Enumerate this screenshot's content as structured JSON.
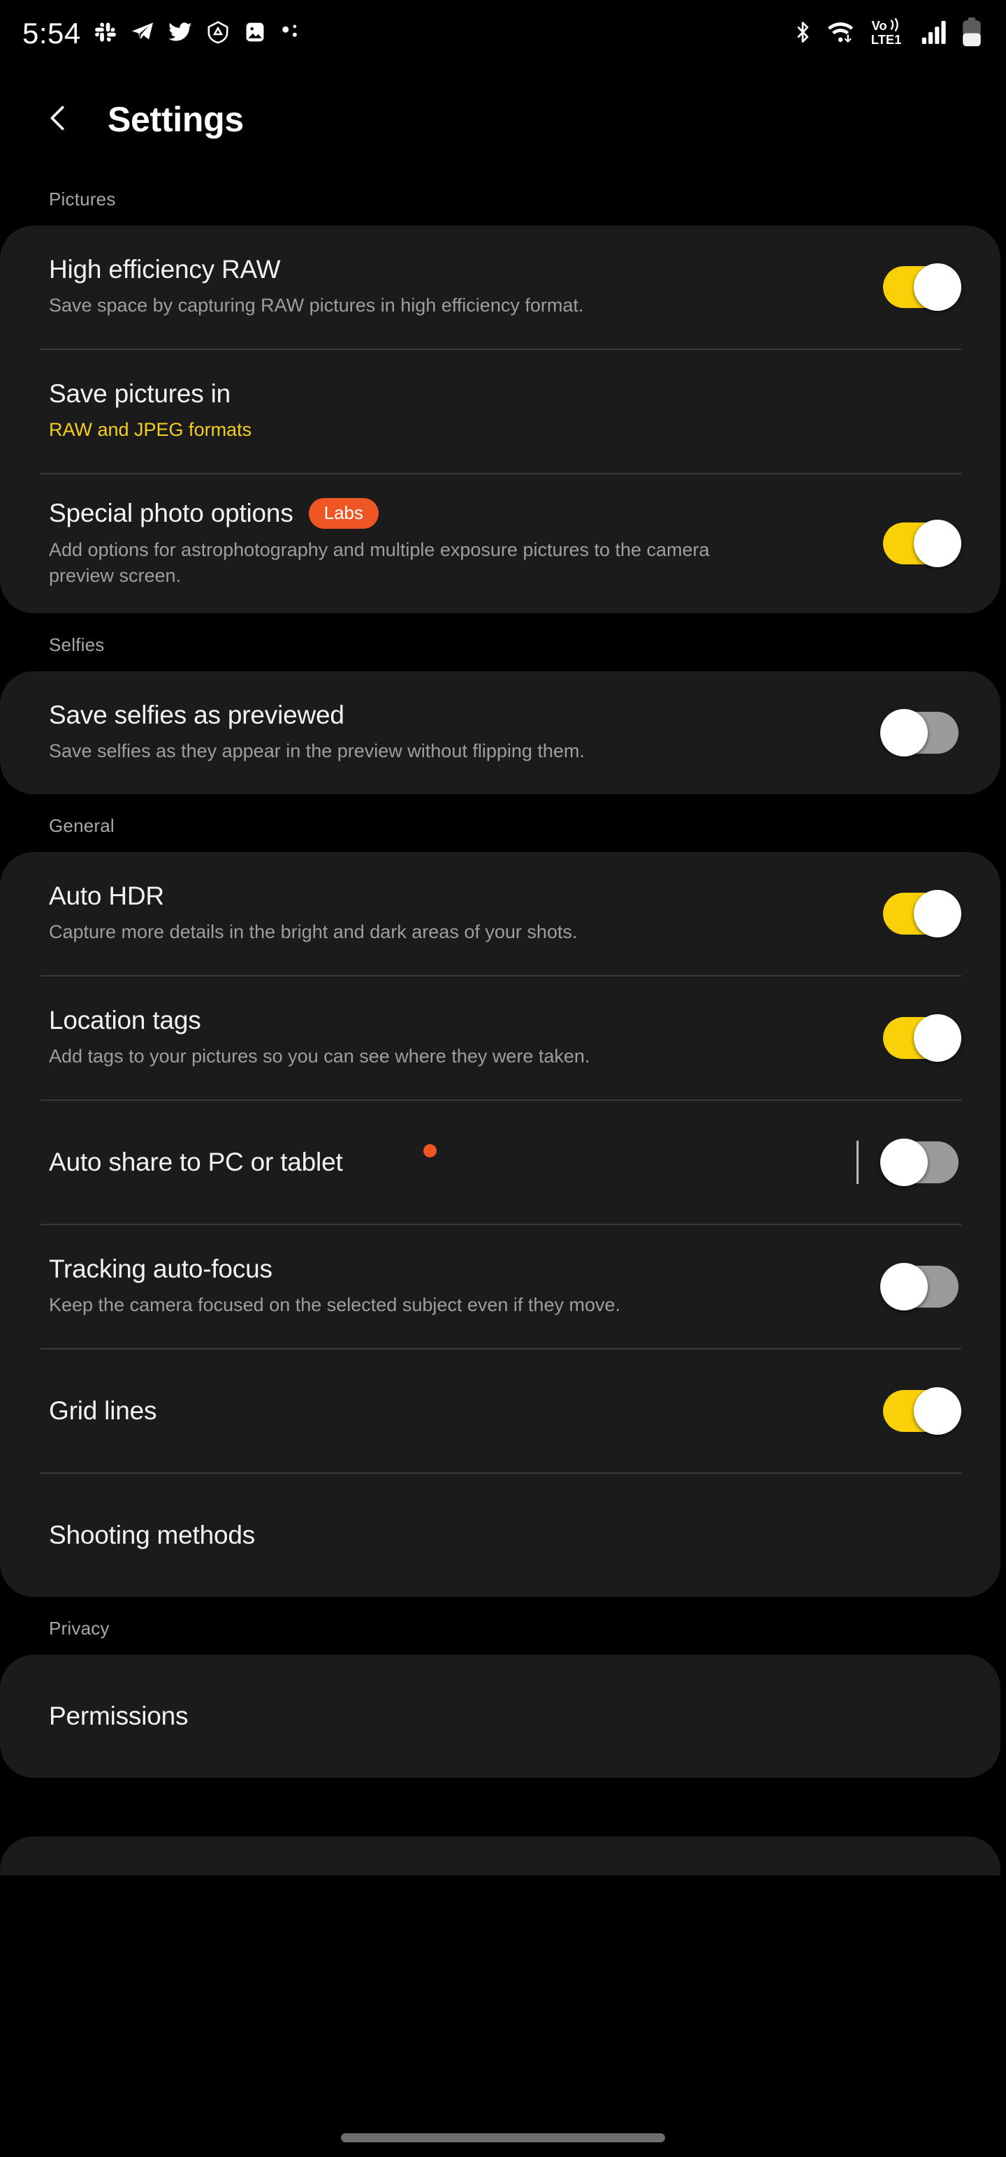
{
  "statusbar": {
    "time": "5:54",
    "left_icons": [
      "slack-icon",
      "telegram-icon",
      "twitter-icon",
      "adguard-icon",
      "gallery-icon",
      "bluetooth-share-icon"
    ],
    "right_icons": [
      "bluetooth-icon",
      "wifi-icon",
      "volte-icon",
      "signal-icon",
      "battery-icon"
    ],
    "network_label": "Vo))",
    "network_label2": "LTE1"
  },
  "header": {
    "back_icon": "chevron-left-icon",
    "title": "Settings"
  },
  "colors": {
    "accent_yellow": "#fad108",
    "labs_orange": "#ee5724",
    "card_bg": "#1b1b1b",
    "page_bg": "#000000"
  },
  "sections": [
    {
      "label": "Pictures",
      "rows": [
        {
          "title": "High efficiency RAW",
          "subtitle": "Save space by capturing RAW pictures in high efficiency format.",
          "control": "toggle",
          "state": "on"
        },
        {
          "title": "Save pictures in",
          "subtitle": "RAW and JPEG formats",
          "subtitle_accent": true,
          "control": "none"
        },
        {
          "title": "Special photo options",
          "badge": "Labs",
          "subtitle": "Add options for astrophotography and multiple exposure pictures to the camera preview screen.",
          "control": "toggle",
          "state": "on"
        }
      ]
    },
    {
      "label": "Selfies",
      "rows": [
        {
          "title": "Save selfies as previewed",
          "subtitle": "Save selfies as they appear in the preview without flipping them.",
          "control": "toggle",
          "state": "off"
        }
      ]
    },
    {
      "label": "General",
      "rows": [
        {
          "title": "Auto HDR",
          "subtitle": "Capture more details in the bright and dark areas of your shots.",
          "control": "toggle",
          "state": "on"
        },
        {
          "title": "Location tags",
          "subtitle": "Add tags to your pictures so you can see where they were taken.",
          "control": "toggle",
          "state": "on"
        },
        {
          "title": "Auto share to PC or tablet",
          "subtitle": "",
          "badge_dot": true,
          "separator": true,
          "control": "toggle",
          "state": "off"
        },
        {
          "title": "Tracking auto-focus",
          "subtitle": "Keep the camera focused on the selected subject even if they move.",
          "control": "toggle",
          "state": "off"
        },
        {
          "title": "Grid lines",
          "subtitle": "",
          "control": "toggle",
          "state": "on"
        },
        {
          "title": "Shooting methods",
          "subtitle": "",
          "control": "none"
        }
      ]
    },
    {
      "label": "Privacy",
      "rows": [
        {
          "title": "Permissions",
          "subtitle": "",
          "control": "none"
        }
      ]
    }
  ]
}
